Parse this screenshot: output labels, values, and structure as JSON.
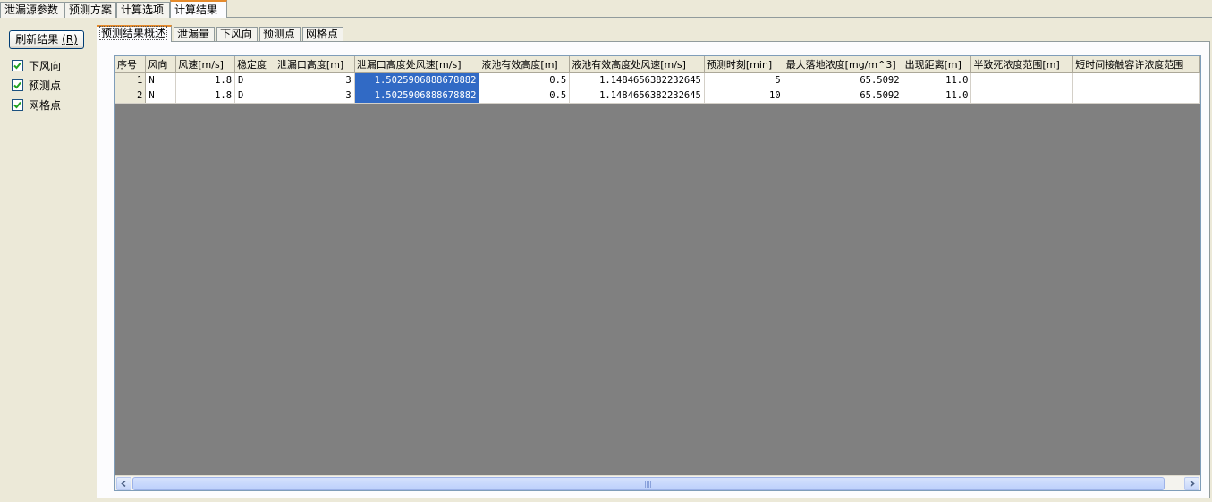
{
  "top_tabs": [
    "泄漏源参数",
    "预测方案",
    "计算选项",
    "计算结果"
  ],
  "active_top_tab": 3,
  "left": {
    "refresh_label": "刷新结果",
    "refresh_hotkey": "(R)",
    "checkboxes": [
      {
        "label": "下风向",
        "checked": true
      },
      {
        "label": "预测点",
        "checked": true
      },
      {
        "label": "网格点",
        "checked": true
      }
    ]
  },
  "sub_tabs": [
    "预测结果概述",
    "泄漏量",
    "下风向",
    "预测点",
    "网格点"
  ],
  "active_sub_tab": 0,
  "table": {
    "columns": [
      "序号",
      "风向",
      "风速[m/s]",
      "稳定度",
      "泄漏口高度[m]",
      "泄漏口高度处风速[m/s]",
      "液池有效高度[m]",
      "液池有效高度处风速[m/s]",
      "预测时刻[min]",
      "最大落地浓度[mg/m^3]",
      "出现距离[m]",
      "半致死浓度范围[m]",
      "短时间接触容许浓度范围"
    ],
    "rows": [
      [
        "1",
        "N",
        "1.8",
        "D",
        "3",
        "1.5025906888678882",
        "0.5",
        "1.1484656382232645",
        "5",
        "65.5092",
        "11.0",
        "",
        ""
      ],
      [
        "2",
        "N",
        "1.8",
        "D",
        "3",
        "1.5025906888678882",
        "0.5",
        "1.1484656382232645",
        "10",
        "65.5092",
        "11.0",
        "",
        ""
      ]
    ],
    "selected_column": 5
  },
  "colors": {
    "selection": "#316ac5",
    "empty_area": "#808080",
    "active_tab_accent": "#e68b2c"
  },
  "icons": {
    "checkbox": "check-icon",
    "scroll_left": "arrow-left-icon",
    "scroll_right": "arrow-right-icon"
  }
}
